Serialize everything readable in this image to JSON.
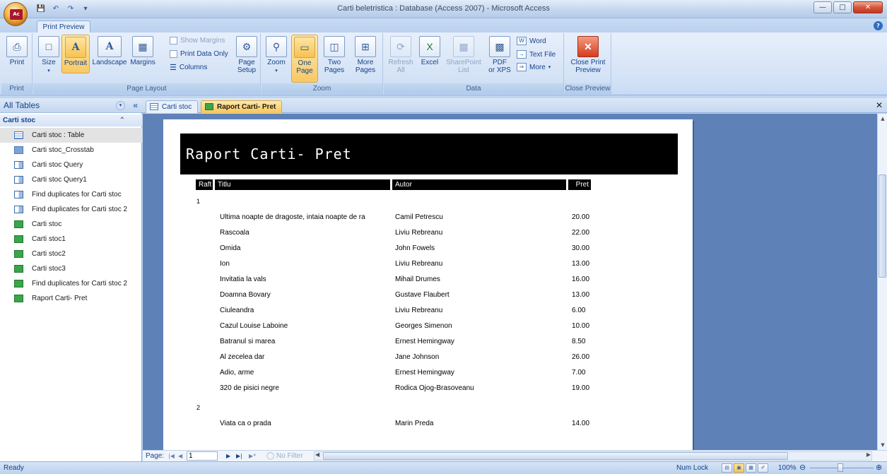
{
  "window": {
    "title": "Carti beletristica : Database (Access 2007) - Microsoft Access",
    "office_logo": "Ac"
  },
  "ribbon": {
    "tab": "Print Preview",
    "groups": {
      "print": {
        "label": "Print",
        "print_btn": "Print"
      },
      "page_layout": {
        "label": "Page Layout",
        "size": "Size",
        "portrait": "Portrait",
        "landscape": "Landscape",
        "margins": "Margins",
        "show_margins": "Show Margins",
        "print_data_only": "Print Data Only",
        "columns": "Columns",
        "page_setup_1": "Page",
        "page_setup_2": "Setup"
      },
      "zoom": {
        "label": "Zoom",
        "zoom": "Zoom",
        "one_page_1": "One",
        "one_page_2": "Page",
        "two_pages_1": "Two",
        "two_pages_2": "Pages",
        "more_pages_1": "More",
        "more_pages_2": "Pages"
      },
      "data": {
        "label": "Data",
        "refresh_1": "Refresh",
        "refresh_2": "All",
        "excel": "Excel",
        "sharepoint_1": "SharePoint",
        "sharepoint_2": "List",
        "pdf_1": "PDF",
        "pdf_2": "or XPS",
        "word": "Word",
        "text_file": "Text File",
        "more": "More"
      },
      "close_preview": {
        "label": "Close Preview",
        "close_1": "Close Print",
        "close_2": "Preview"
      }
    }
  },
  "nav": {
    "header": "All Tables",
    "group": "Carti stoc",
    "items": [
      {
        "label": "Carti stoc : Table",
        "icon": "table-icon"
      },
      {
        "label": "Carti stoc_Crosstab",
        "icon": "crosstab-query-icon"
      },
      {
        "label": "Carti stoc Query",
        "icon": "query-icon"
      },
      {
        "label": "Carti stoc Query1",
        "icon": "query-icon"
      },
      {
        "label": "Find duplicates for Carti stoc",
        "icon": "query-icon"
      },
      {
        "label": "Find duplicates for Carti stoc 2",
        "icon": "query-icon"
      },
      {
        "label": "Carti stoc",
        "icon": "report-icon"
      },
      {
        "label": "Carti stoc1",
        "icon": "report-icon"
      },
      {
        "label": "Carti stoc2",
        "icon": "report-icon"
      },
      {
        "label": "Carti stoc3",
        "icon": "report-icon"
      },
      {
        "label": "Find duplicates for Carti stoc 2",
        "icon": "report-icon"
      },
      {
        "label": "Raport Carti- Pret",
        "icon": "report-icon"
      }
    ]
  },
  "doc_tabs": [
    {
      "label": "Carti stoc",
      "icon": "table-icon"
    },
    {
      "label": "Raport Carti- Pret",
      "icon": "report-icon",
      "active": true
    }
  ],
  "report": {
    "title": "Raport Carti- Pret",
    "columns": {
      "raft": "Raft",
      "titlu": "Titlu",
      "autor": "Autor",
      "pret": "Pret"
    },
    "groups": [
      {
        "raft": "1",
        "rows": [
          {
            "titlu": "Ultima noapte de dragoste, intaia noapte de ra",
            "autor": "Camil Petrescu",
            "pret": "20.00"
          },
          {
            "titlu": "Rascoala",
            "autor": "Liviu Rebreanu",
            "pret": "22.00"
          },
          {
            "titlu": "Omida",
            "autor": "John Fowels",
            "pret": "30.00"
          },
          {
            "titlu": "Ion",
            "autor": "Liviu Rebreanu",
            "pret": "13.00"
          },
          {
            "titlu": "Invitatia la vals",
            "autor": "Mihail Drumes",
            "pret": "16.00"
          },
          {
            "titlu": "Doamna Bovary",
            "autor": "Gustave Flaubert",
            "pret": "13.00"
          },
          {
            "titlu": "Ciuleandra",
            "autor": "Liviu Rebreanu",
            "pret": "6.00"
          },
          {
            "titlu": "Cazul Louise Laboine",
            "autor": "Georges Simenon",
            "pret": "10.00"
          },
          {
            "titlu": "Batranul si marea",
            "autor": "Ernest Hemingway",
            "pret": "8.50"
          },
          {
            "titlu": "Al zecelea dar",
            "autor": "Jane Johnson",
            "pret": "26.00"
          },
          {
            "titlu": "Adio, arme",
            "autor": "Ernest Hemingway",
            "pret": "7.00"
          },
          {
            "titlu": "320 de pisici negre",
            "autor": "Rodica Ojog-Brasoveanu",
            "pret": "19.00"
          }
        ]
      },
      {
        "raft": "2",
        "rows": [
          {
            "titlu": "Viata ca o prada",
            "autor": "Marin Preda",
            "pret": "14.00"
          }
        ]
      }
    ]
  },
  "record_nav": {
    "page_label": "Page:",
    "page_value": "1",
    "no_filter": "No Filter"
  },
  "status": {
    "ready": "Ready",
    "num_lock": "Num Lock",
    "zoom": "100%"
  },
  "colors": {
    "ribbon_bg": "#d5e3f6",
    "accent_active": "#f9c45a",
    "preview_bg": "#5e82b7"
  }
}
